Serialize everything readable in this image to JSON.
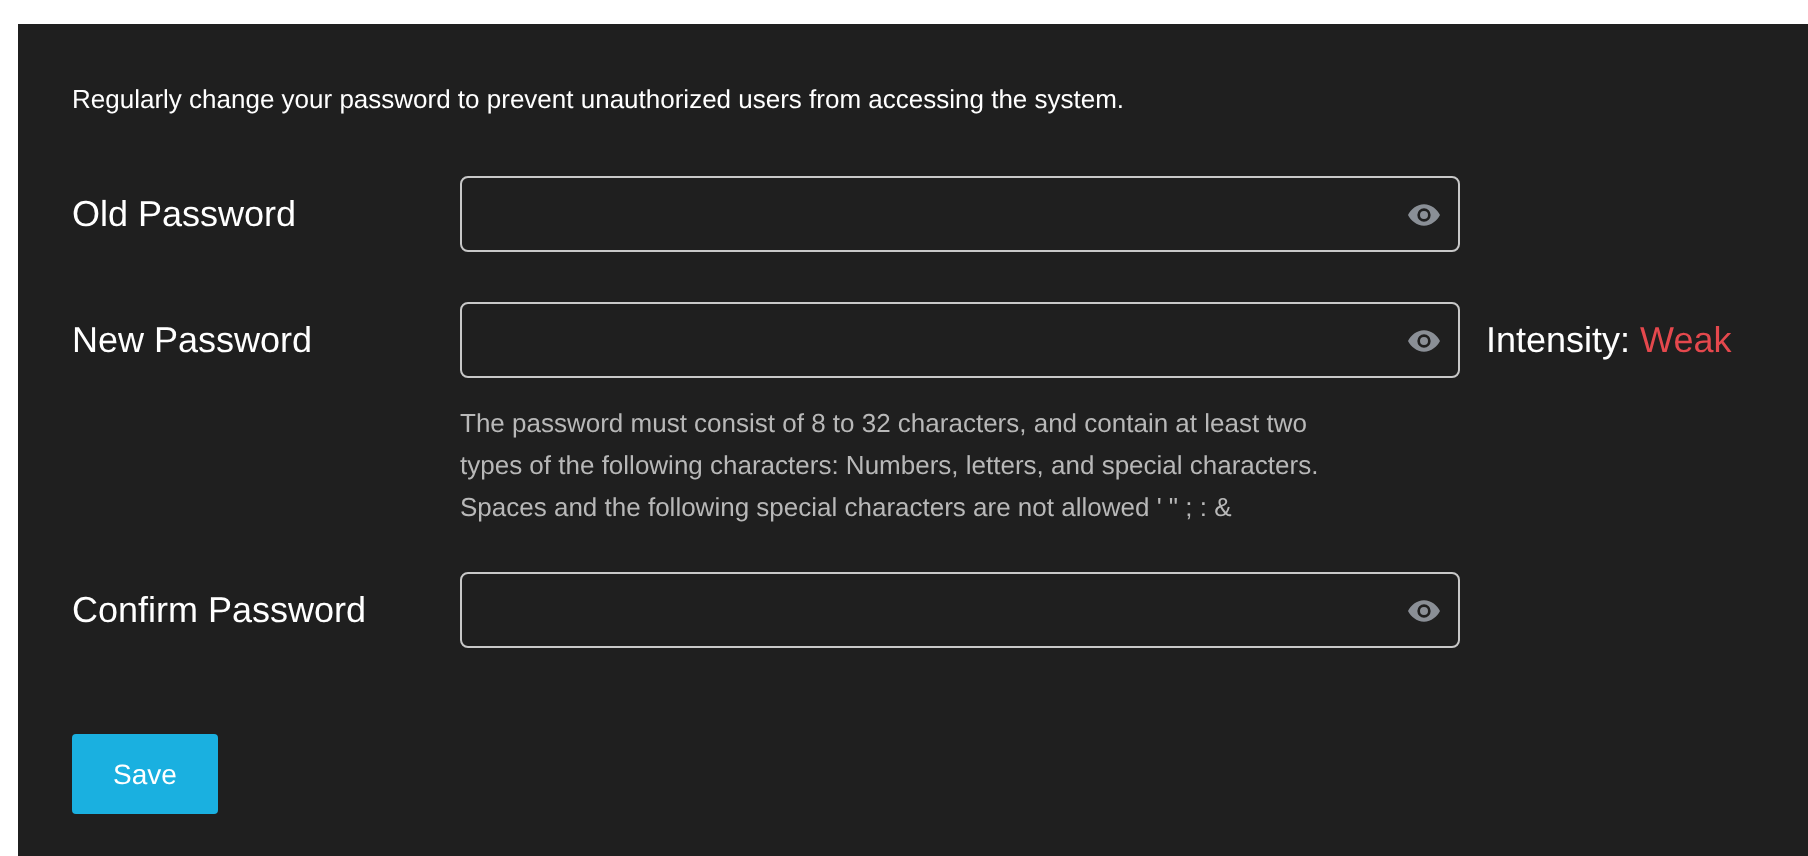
{
  "intro": "Regularly change your password to prevent unauthorized users from accessing the system.",
  "fields": [
    {
      "label": "Old Password"
    },
    {
      "label": "New Password",
      "strength": {
        "label": "Intensity:",
        "value": "Weak",
        "kind": "weak"
      },
      "hint": [
        "The password must consist of 8 to 32 characters, and contain at least two",
        "types of the following characters: Numbers, letters, and special characters.",
        "Spaces and the following special characters are not allowed ' \" ; : &"
      ]
    },
    {
      "label": "Confirm Password"
    }
  ],
  "save_button": "Save"
}
